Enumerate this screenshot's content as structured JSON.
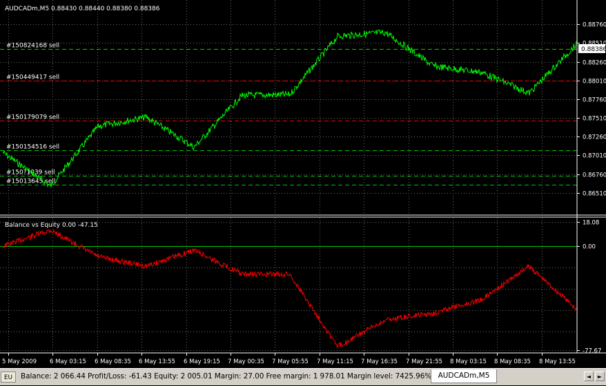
{
  "main_chart": {
    "header": "AUDCADm,M5  0.88430 0.88440 0.88380 0.88386",
    "symbol": "AUDCADm,M5",
    "ohlc": [
      "0.88430",
      "0.88440",
      "0.88380",
      "0.88386"
    ],
    "current_price": "0.88386",
    "line_color": "#00ff00",
    "y_ticks": [
      "0.88760",
      "0.88510",
      "0.88260",
      "0.88010",
      "0.87760",
      "0.87510",
      "0.87260",
      "0.87010",
      "0.86760",
      "0.86510"
    ],
    "orders": [
      {
        "label": "#150824168 sell",
        "price": 0.8843
      },
      {
        "label": "#150449417 sell",
        "price": 0.8801
      },
      {
        "label": "#150179079 sell",
        "price": 0.8747
      },
      {
        "label": "#150154516 sell",
        "price": 0.8708
      },
      {
        "label": "#150?1039 sell",
        "price": 0.8674
      },
      {
        "label": "#15013645 sell",
        "price": 0.8662
      }
    ]
  },
  "indicator": {
    "title": "Balance vs Equity 0.00 -47.15",
    "y_ticks": [
      "18.08",
      "0.00",
      "-77.67"
    ],
    "zero_line_color": "#00cc00",
    "line_color": "#ff0000"
  },
  "x_ticks": [
    "5 May 2009",
    "6 May 03:15",
    "6 May 08:35",
    "6 May 13:55",
    "6 May 19:15",
    "7 May 00:35",
    "7 May 05:55",
    "7 May 11:15",
    "7 May 16:35",
    "7 May 21:55",
    "8 May 03:15",
    "8 May 08:35",
    "8 May 13:55"
  ],
  "chart_data": [
    {
      "type": "line",
      "title": "AUDCADm,M5",
      "x": [
        "5 May 2009",
        "6 May 03:15",
        "6 May 08:35",
        "6 May 13:55",
        "6 May 19:15",
        "7 May 00:35",
        "7 May 05:55",
        "7 May 11:15",
        "7 May 16:35",
        "7 May 21:55",
        "8 May 03:15",
        "8 May 08:35",
        "8 May 13:55"
      ],
      "series": [
        {
          "name": "AUDCADm,M5",
          "values": [
            0.8705,
            0.866,
            0.874,
            0.8752,
            0.8712,
            0.8781,
            0.8782,
            0.886,
            0.8865,
            0.882,
            0.8812,
            0.8784,
            0.885
          ]
        }
      ],
      "ylim": [
        0.8649,
        0.8889
      ],
      "grid": true
    },
    {
      "type": "line",
      "title": "Balance vs Equity 0.00 -47.15",
      "x": [
        "5 May 2009",
        "6 May 03:15",
        "6 May 08:35",
        "6 May 13:55",
        "6 May 19:15",
        "7 May 00:35",
        "7 May 05:55",
        "7 May 11:15",
        "7 May 16:35",
        "7 May 21:55",
        "8 May 03:15",
        "8 May 08:35",
        "8 May 13:55"
      ],
      "series": [
        {
          "name": "Equity",
          "values": [
            0.0,
            12.0,
            -8.0,
            -15.0,
            -3.0,
            -21.0,
            -21.0,
            -75.0,
            -55.0,
            -50.0,
            -40.0,
            -15.0,
            -47.15
          ]
        }
      ],
      "ylim": [
        -77.67,
        18.08
      ],
      "grid": true
    }
  ],
  "status": {
    "eu_label": "EU",
    "text": "Balance: 2 066.44  Profit/Loss: -61.43  Equity: 2 005.01  Margin: 27.00  Free margin: 1 978.01  Margin level: 7425.96%",
    "tab_label": "AUDCADm,M5",
    "arrow_left": "◄",
    "arrow_right": "►"
  }
}
